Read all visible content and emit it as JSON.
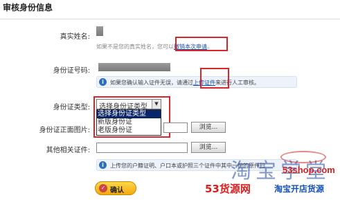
{
  "page": {
    "title": "审核身份信息"
  },
  "real_name": {
    "label": "真实姓名:",
    "hint_prefix": "如果不是您的真实姓名，您可以",
    "link_text": "撤销本次申请",
    "hint_suffix": "。"
  },
  "id_number": {
    "label": "身份证号码:"
  },
  "id_info": {
    "prefix": "如果您确认输入证件无误，请通过",
    "link_text": "上传证件",
    "suffix": "来进行人工审核。"
  },
  "id_type": {
    "label": "身份证类型:",
    "selected": "选择身份证类型",
    "options": [
      "选择身份证类型",
      "新版身份证",
      "老版身份证"
    ]
  },
  "id_front": {
    "label": "身份证正面图片:",
    "browse_label": "浏览..."
  },
  "other_docs": {
    "label": "其他相关证件:",
    "browse_label": "浏览..."
  },
  "upload_info": {
    "text": "上传您的户籍证明、户口本或护照三个证件中其中一份的原件扫"
  },
  "confirm": {
    "label": "确认",
    "icon": "check-icon"
  },
  "watermark": {
    "brand_cn": "淘宝学堂",
    "url": "53shop.com",
    "site_name": "53货源网",
    "tagline": "淘宝开店货源"
  },
  "colors": {
    "highlight_box": "#d8262d",
    "link": "#1a4fa0",
    "info_icon": "#2b6fc2",
    "confirm_button": "#f3a80e"
  }
}
